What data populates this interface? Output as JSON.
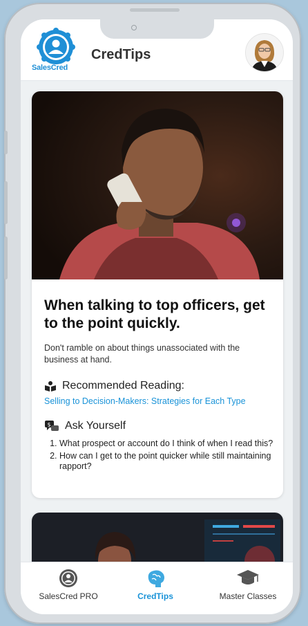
{
  "header": {
    "logo_text": "SalesCred",
    "title": "CredTips"
  },
  "tip": {
    "headline": "When talking to top officers, get to the point quickly.",
    "summary": "Don't ramble on about things unassociated with the business at hand.",
    "recommended_label": "Recommended Reading:",
    "recommended_link": "Selling to Decision-Makers: Strategies for Each Type",
    "ask_label": "Ask Yourself",
    "questions": [
      "What prospect or account do I think of when I read this?",
      "How can I get to the point quicker while still maintaining rapport?"
    ]
  },
  "nav": {
    "items": [
      {
        "label": "SalesCred PRO",
        "icon": "person-badge-icon"
      },
      {
        "label": "CredTips",
        "icon": "brain-icon",
        "active": true
      },
      {
        "label": "Master Classes",
        "icon": "graduation-cap-icon"
      }
    ]
  },
  "colors": {
    "accent": "#1a93d8",
    "background": "#a9c7dc"
  }
}
